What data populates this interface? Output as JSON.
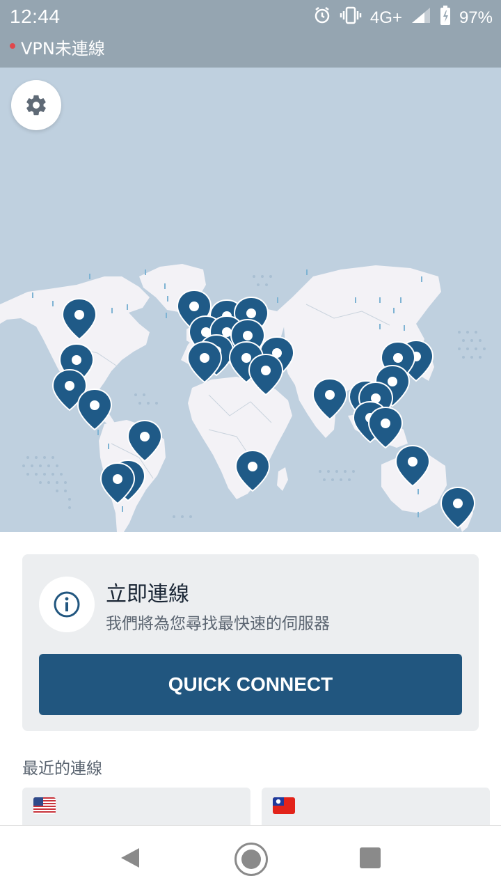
{
  "status_bar": {
    "time": "12:44",
    "network": "4G+",
    "battery": "97%",
    "vpn_status": "VPN未連線",
    "icons": [
      "alarm-icon",
      "vibrate-icon",
      "signal-icon",
      "battery-icon"
    ]
  },
  "map": {
    "settings_icon": "gear-icon",
    "pin_color": "#1f5a87",
    "background": "#bfd0df"
  },
  "quick_connect": {
    "title": "立即連線",
    "subtitle": "我們將為您尋找最快速的伺服器",
    "button_label": "QUICK CONNECT",
    "info_icon": "info-icon"
  },
  "recent": {
    "label": "最近的連線",
    "items": [
      {
        "flag": "us-flag-icon"
      },
      {
        "flag": "tw-flag-icon"
      }
    ]
  },
  "nav": {
    "icons": [
      "back-icon",
      "home-icon",
      "recents-icon"
    ]
  },
  "colors": {
    "accent": "#21567f",
    "status_bar": "#95a5b1",
    "vpn_dot": "#e0474c"
  }
}
